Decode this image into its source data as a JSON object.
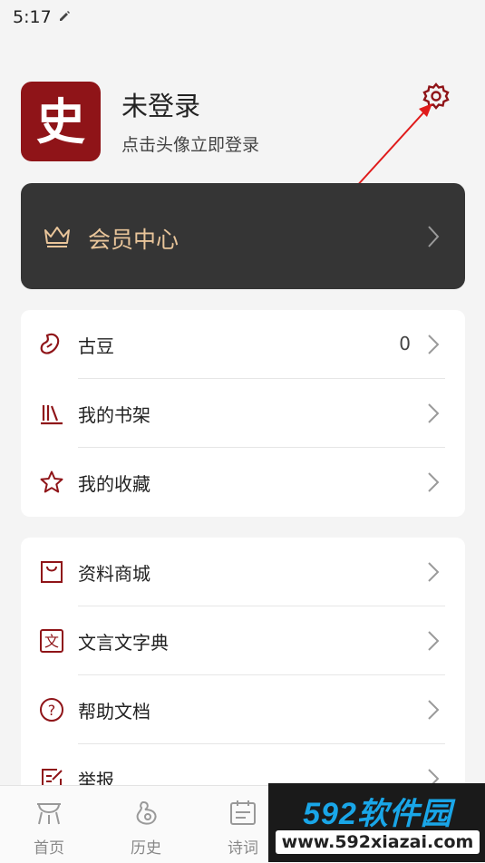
{
  "status_bar": {
    "time": "5:17"
  },
  "profile": {
    "avatar_char": "史",
    "name": "未登录",
    "hint": "点击头像立即登录"
  },
  "vip": {
    "label": "会员中心"
  },
  "section1": [
    {
      "label": "古豆",
      "value": "0",
      "icon": "bean-icon"
    },
    {
      "label": "我的书架",
      "icon": "bookshelf-icon"
    },
    {
      "label": "我的收藏",
      "icon": "star-icon"
    }
  ],
  "section2": [
    {
      "label": "资料商城",
      "icon": "shopping-bag-icon"
    },
    {
      "label": "文言文字典",
      "icon": "dictionary-icon",
      "icon_char": "文"
    },
    {
      "label": "帮助文档",
      "icon": "help-icon",
      "icon_char": "?"
    },
    {
      "label": "举报",
      "icon": "report-icon"
    }
  ],
  "tabs": [
    {
      "label": "首页",
      "icon": "home-icon"
    },
    {
      "label": "历史",
      "icon": "history-icon"
    },
    {
      "label": "诗词",
      "icon": "calendar-icon"
    }
  ],
  "watermark": {
    "title": "592软件园",
    "url": "www.592xiazai.com"
  },
  "colors": {
    "brand": "#8f1418",
    "vip_bg": "#353535",
    "vip_text": "#e9c59a",
    "annotation": "#e01b1b"
  }
}
